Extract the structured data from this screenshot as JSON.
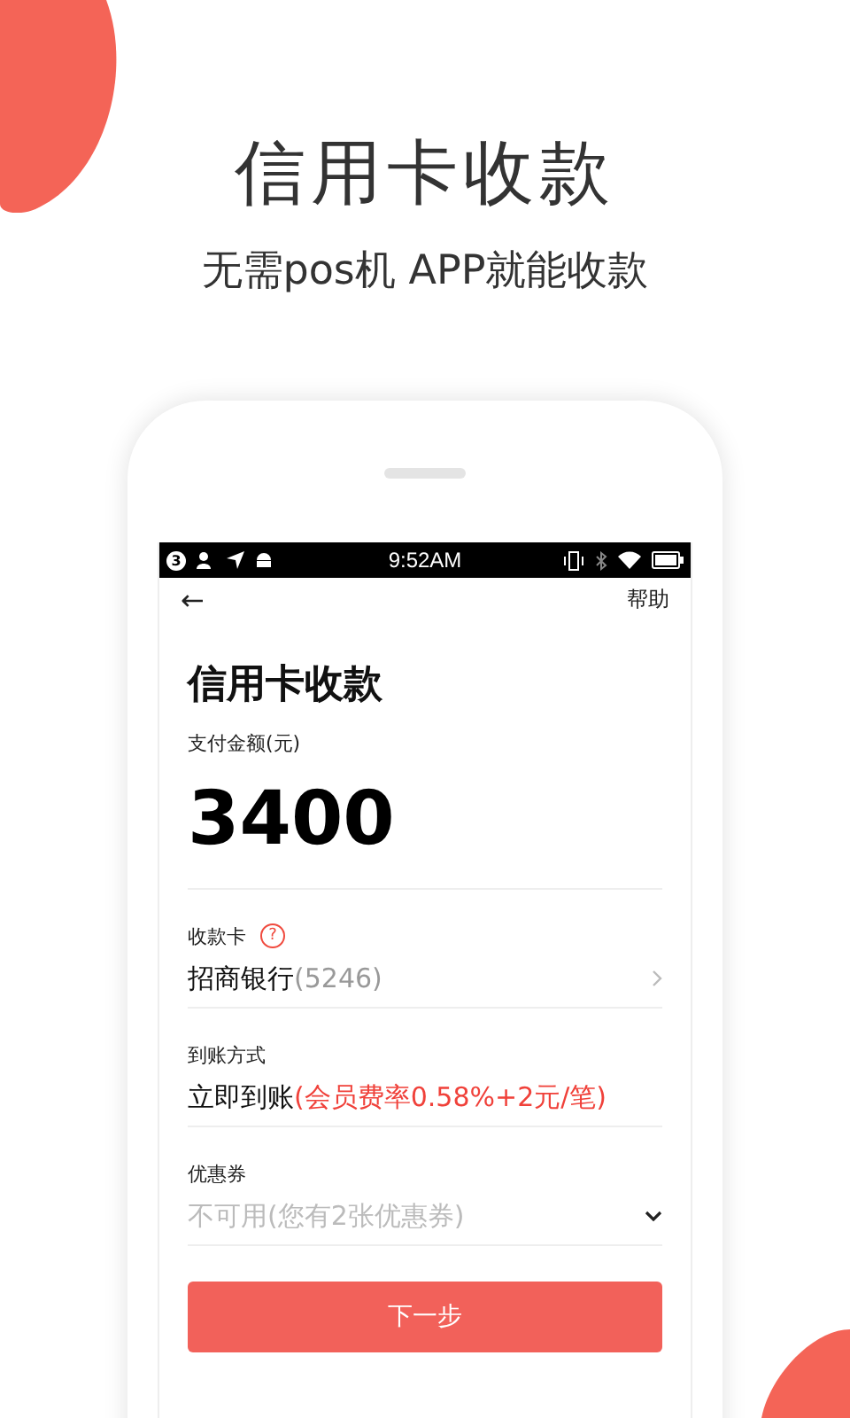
{
  "headline": "信用卡收款",
  "subheadline": "无需pos机 APP就能收款",
  "status_bar": {
    "notification_count": "3",
    "time": "9:52AM"
  },
  "nav": {
    "back": "←",
    "action": "帮助"
  },
  "form": {
    "title": "信用卡收款",
    "amount_label": "支付金额(元)",
    "amount": "3400",
    "fields": [
      {
        "kind": "card",
        "label": "收款卡",
        "help": "?",
        "value": "招商银行",
        "suffix": "(5246)"
      },
      {
        "kind": "fee",
        "label": "到账方式",
        "value": "立即到账",
        "suffix": "(会员费率0.58%+2元/笔)"
      },
      {
        "kind": "select",
        "label": "优惠券",
        "value": "不可用(您有2张优惠券)",
        "disabled": true
      }
    ]
  },
  "submit": "下一步"
}
